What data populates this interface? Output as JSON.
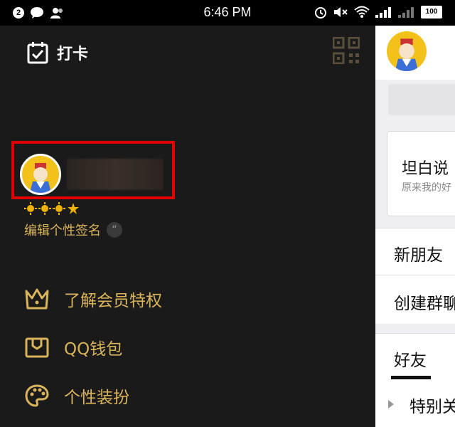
{
  "status_bar": {
    "notification_count": "2",
    "time": "6:46 PM",
    "battery": "100"
  },
  "drawer": {
    "checkin_label": "打卡",
    "signature_label": "编辑个性签名",
    "signature_quote": "“",
    "menu": [
      {
        "label": "了解会员特权",
        "icon": "crown-icon"
      },
      {
        "label": "QQ钱包",
        "icon": "wallet-icon"
      },
      {
        "label": "个性装扮",
        "icon": "palette-icon"
      }
    ]
  },
  "peek": {
    "card_title": "坦白说",
    "card_sub": "原来我的好",
    "rows": [
      "新朋友",
      "创建群聊"
    ],
    "tab_friends": "好友",
    "special_label": "特别关"
  },
  "colors": {
    "accent_gold": "#d9b45a",
    "drawer_bg": "#1a1a1a",
    "highlight_red": "#e00000"
  }
}
